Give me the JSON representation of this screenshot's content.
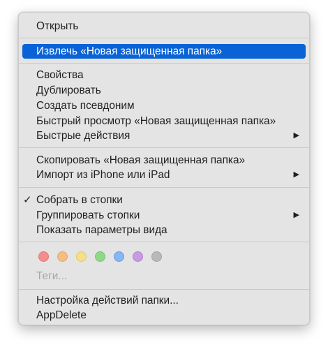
{
  "menu": {
    "open": "Открыть",
    "eject": "Извлечь «Новая защищенная папка»",
    "properties": "Свойства",
    "duplicate": "Дублировать",
    "make_alias": "Создать псевдоним",
    "quick_look": "Быстрый просмотр «Новая защищенная папка»",
    "quick_actions": "Быстрые действия",
    "copy": "Скопировать «Новая защищенная папка»",
    "import": "Импорт из iPhone или iPad",
    "use_stacks": "Собрать в стопки",
    "group_stacks": "Группировать стопки",
    "show_view_options": "Показать параметры вида",
    "tags": "Теги...",
    "folder_actions": "Настройка действий папки...",
    "appdelete": "AppDelete",
    "checkmark": "✓",
    "submenu_arrow": "▶"
  },
  "tag_colors": [
    {
      "name": "red",
      "fill": "#f08f8c",
      "border": "#e07774"
    },
    {
      "name": "orange",
      "fill": "#f4bd84",
      "border": "#e5a86c"
    },
    {
      "name": "yellow",
      "fill": "#f5df8a",
      "border": "#e3c96c"
    },
    {
      "name": "green",
      "fill": "#8fd88a",
      "border": "#74c56f"
    },
    {
      "name": "blue",
      "fill": "#86b6f3",
      "border": "#6d9fe2"
    },
    {
      "name": "purple",
      "fill": "#c89ae0",
      "border": "#b382cf"
    },
    {
      "name": "gray",
      "fill": "#b9b9b9",
      "border": "#a3a3a3"
    }
  ],
  "colors": {
    "highlight": "#0a63d6",
    "menu_background": "#e4e4e4",
    "separator": "#c8c8c8"
  }
}
